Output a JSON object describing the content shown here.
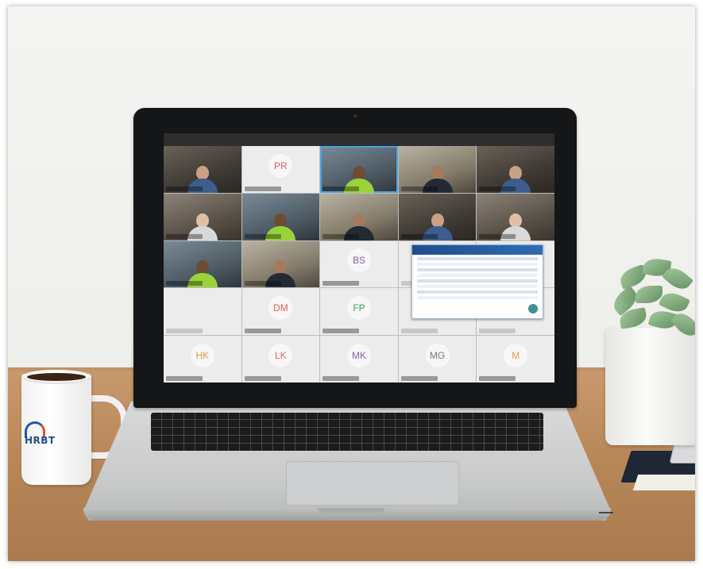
{
  "scene": {
    "description_colors": {
      "wall": "#efefec",
      "desk": "#b88859",
      "laptop_bezel": "#151617",
      "mug_logo_blue": "#1f4d8c",
      "mug_logo_red": "#e34b2f",
      "meeting_highlight": "#4aa3df"
    },
    "meeting_tiles": [
      {
        "kind": "video"
      },
      {
        "kind": "initials",
        "text": "PR",
        "color": "red"
      },
      {
        "kind": "video",
        "active": true
      },
      {
        "kind": "video"
      },
      {
        "kind": "video"
      },
      {
        "kind": "video"
      },
      {
        "kind": "video"
      },
      {
        "kind": "video"
      },
      {
        "kind": "video"
      },
      {
        "kind": "video"
      },
      {
        "kind": "video"
      },
      {
        "kind": "video"
      },
      {
        "kind": "initials",
        "text": "BS",
        "color": "purple"
      },
      {
        "kind": "blank"
      },
      {
        "kind": "blank"
      },
      {
        "kind": "blank"
      },
      {
        "kind": "initials",
        "text": "DM",
        "color": "red"
      },
      {
        "kind": "initials",
        "text": "FP",
        "color": "green"
      },
      {
        "kind": "blank"
      },
      {
        "kind": "blank"
      },
      {
        "kind": "initials",
        "text": "HK",
        "color": "orange"
      },
      {
        "kind": "initials",
        "text": "LK",
        "color": "red"
      },
      {
        "kind": "initials",
        "text": "MK",
        "color": "purple"
      },
      {
        "kind": "initials",
        "text": "MG",
        "color": "gray"
      },
      {
        "kind": "initials",
        "text": "M",
        "color": "orange"
      }
    ],
    "mug_logo_text": "HRBT"
  }
}
